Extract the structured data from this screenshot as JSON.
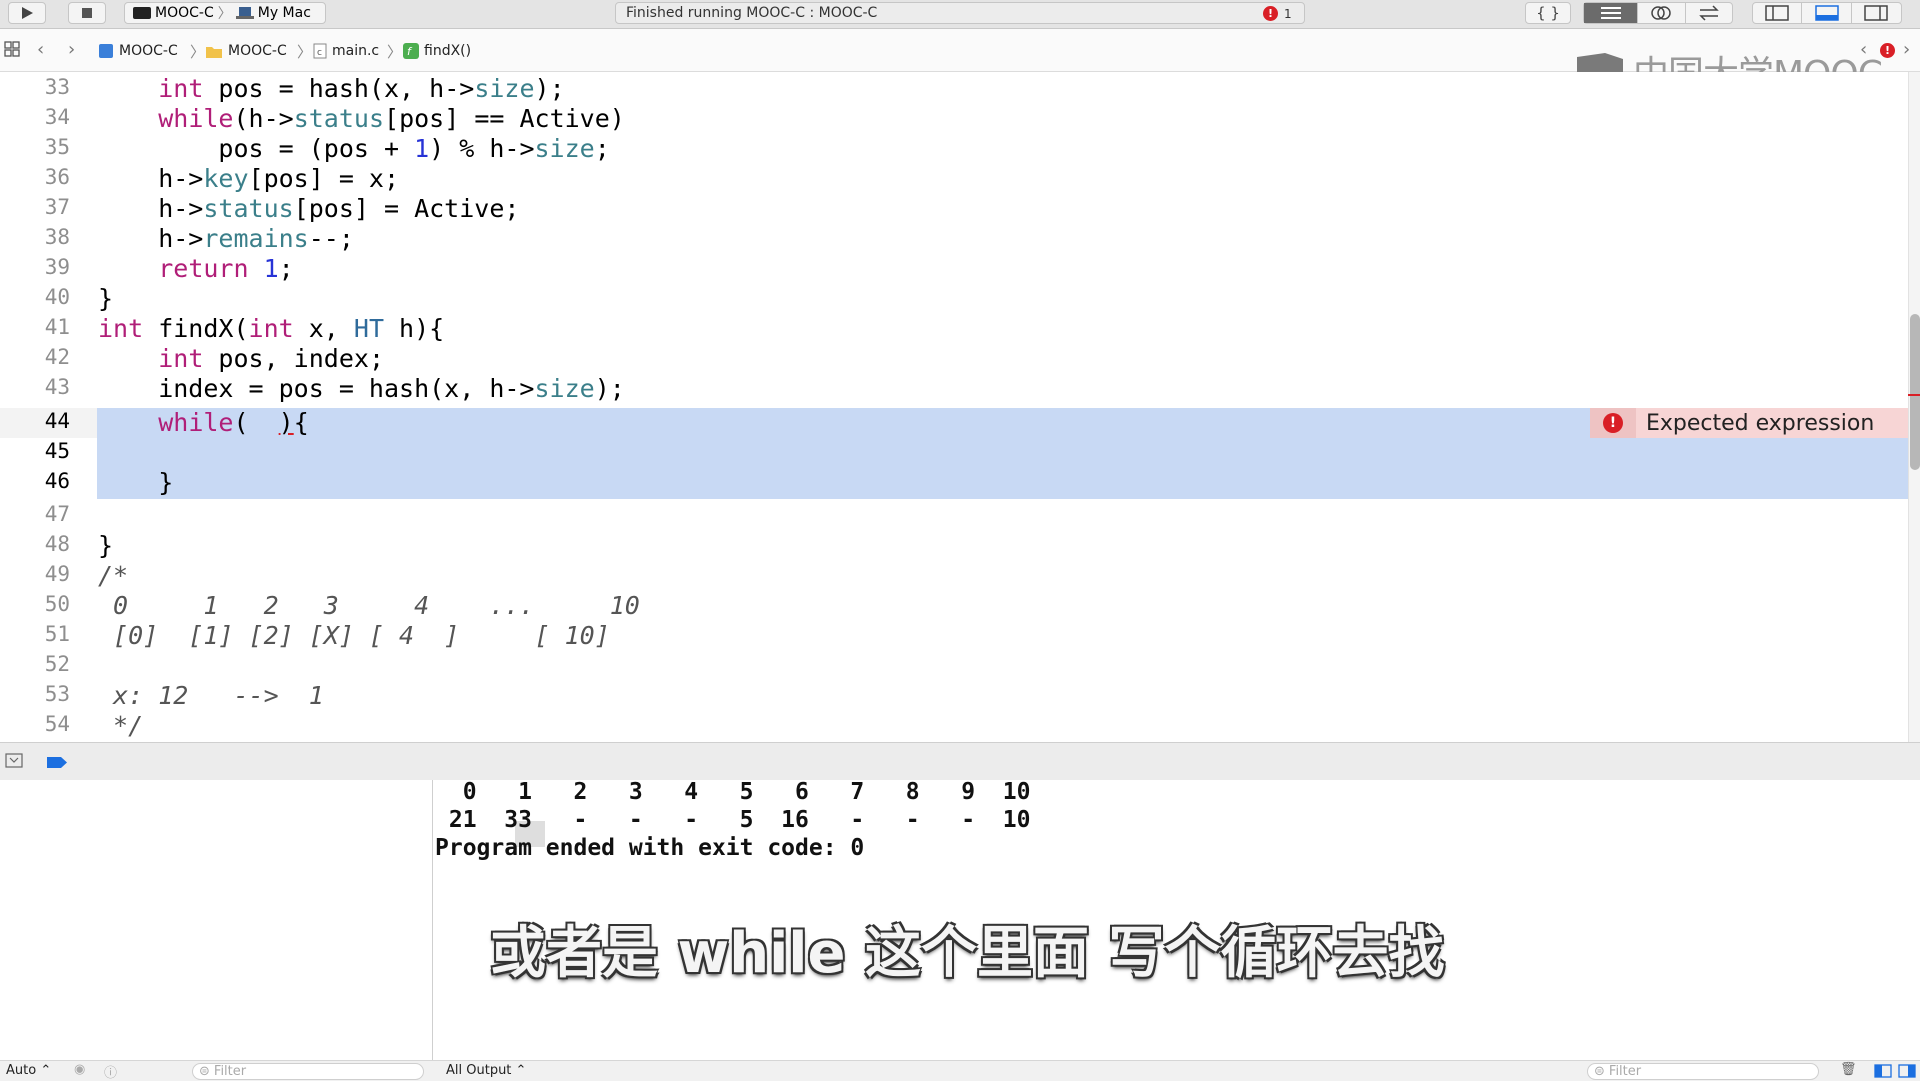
{
  "toolbar": {
    "scheme_target": "MOOC-C",
    "scheme_device": "My Mac",
    "status_text": "Finished running MOOC-C : MOOC-C",
    "issue_count": "1"
  },
  "jumpbar": {
    "crumbs": [
      "MOOC-C",
      "MOOC-C",
      "main.c",
      "findX()"
    ]
  },
  "watermark": "中国大学MOOC",
  "editor": {
    "lines": [
      {
        "n": "33"
      },
      {
        "n": "34"
      },
      {
        "n": "35"
      },
      {
        "n": "36"
      },
      {
        "n": "37"
      },
      {
        "n": "38"
      },
      {
        "n": "39"
      },
      {
        "n": "40"
      },
      {
        "n": "41"
      },
      {
        "n": "42"
      },
      {
        "n": "43"
      },
      {
        "n": "44"
      },
      {
        "n": "45"
      },
      {
        "n": "46"
      },
      {
        "n": "47"
      },
      {
        "n": "48"
      },
      {
        "n": "49"
      },
      {
        "n": "50"
      },
      {
        "n": "51"
      },
      {
        "n": "52"
      },
      {
        "n": "53"
      },
      {
        "n": "54"
      }
    ],
    "comment": {
      "l50": " 0     1   2   3     4    ...     10",
      "l51": " [0]  [1] [2] [X] [ 4  ]     [ 10]",
      "l53": " x: 12   -->  1",
      "l54": " */"
    },
    "error_message": "Expected expression"
  },
  "console": {
    "row_header": "  0   1   2   3   4   5   6   7   8   9  10",
    "row_values": " 21  33   -   -   -   5  16   -   -   -  10",
    "exit_line": "Program ended with exit code: 0"
  },
  "subtitle": "或者是 while 这个里面 写个循环去找",
  "bottom": {
    "auto_label": "Auto ⌃",
    "filter_placeholder": "Filter",
    "output_label": "All Output ⌃",
    "filter_placeholder_right": "Filter"
  }
}
